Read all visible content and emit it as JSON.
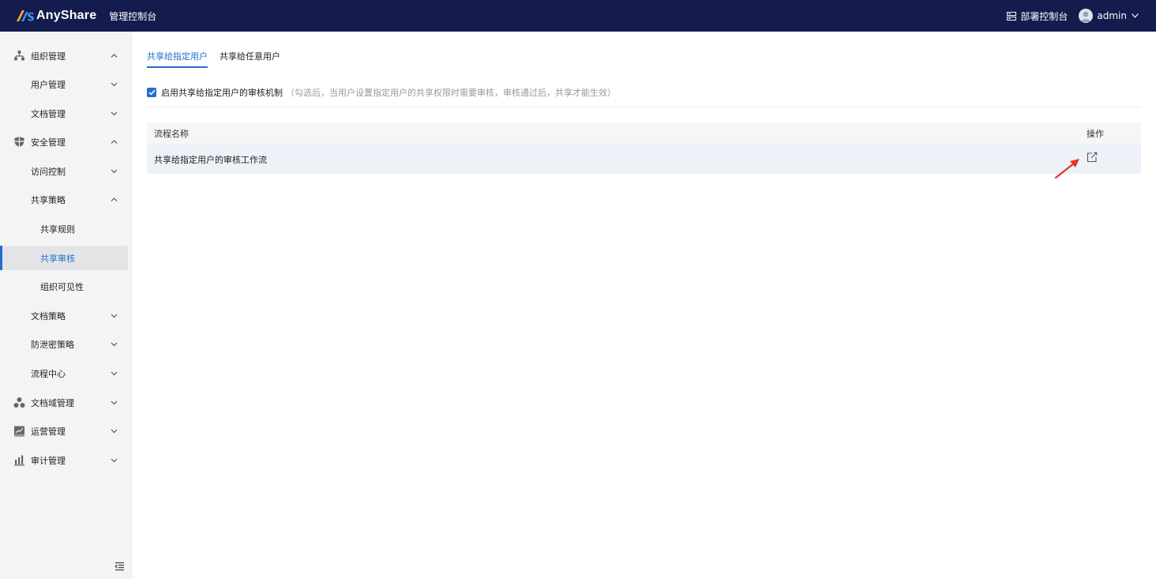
{
  "header": {
    "logo_text": "AnyShare",
    "console_title": "管理控制台",
    "deploy_label": "部署控制台",
    "user_name": "admin"
  },
  "sidebar": {
    "items": [
      {
        "label": "组织管理",
        "icon": "org-icon",
        "expanded": true
      },
      {
        "label": "用户管理",
        "expanded": false
      },
      {
        "label": "文档管理",
        "expanded": false
      },
      {
        "label": "安全管理",
        "icon": "shield-icon",
        "expanded": true
      },
      {
        "label": "访问控制",
        "expanded": false
      },
      {
        "label": "共享策略",
        "expanded": true
      },
      {
        "label": "共享规则"
      },
      {
        "label": "共享审核",
        "active": true
      },
      {
        "label": "组织可见性"
      },
      {
        "label": "文档策略",
        "expanded": false
      },
      {
        "label": "防泄密策略",
        "expanded": false
      },
      {
        "label": "流程中心",
        "expanded": false
      },
      {
        "label": "文档域管理",
        "icon": "domain-icon",
        "expanded": false
      },
      {
        "label": "运营管理",
        "icon": "chart-line-icon",
        "expanded": false
      },
      {
        "label": "审计管理",
        "icon": "bar-chart-icon",
        "expanded": false
      }
    ]
  },
  "main": {
    "tabs": [
      {
        "label": "共享给指定用户",
        "active": true
      },
      {
        "label": "共享给任意用户",
        "active": false
      }
    ],
    "audit_checkbox": {
      "checked": true,
      "label": "启用共享给指定用户的审核机制",
      "hint": "（勾选后，当用户设置指定用户的共享权限时需要审核，审核通过后，共享才能生效）"
    },
    "table": {
      "columns": [
        "流程名称",
        "操作"
      ],
      "rows": [
        {
          "name": "共享给指定用户的审核工作流",
          "action_icon": "edit-icon"
        }
      ]
    }
  },
  "colors": {
    "topbar": "#141b4d",
    "accent": "#1f6fd0",
    "annotation_arrow": "#e8322a"
  }
}
